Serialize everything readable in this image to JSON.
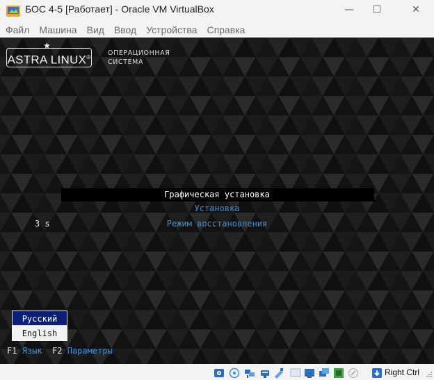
{
  "window": {
    "title": "БОС 4-5 [Работает] - Oracle VM VirtualBox",
    "minimize_glyph": "—",
    "maximize_glyph": "☐",
    "close_glyph": "✕"
  },
  "menubar": {
    "items": [
      "Файл",
      "Машина",
      "Вид",
      "Ввод",
      "Устройства",
      "Справка"
    ]
  },
  "vm": {
    "logo_text": "ASTRA LINUX",
    "logo_reg": "®",
    "logo_subtitle_line1": "ОПЕРАЦИОННАЯ",
    "logo_subtitle_line2": "СИСТЕМА",
    "boot_menu": {
      "items": [
        "Графическая установка",
        "Установка",
        "Режим восстановления"
      ],
      "selected_index": 0
    },
    "timer": "3 s",
    "language_list": [
      "Русский",
      "English"
    ],
    "language_selected": "Русский",
    "fkeys": [
      {
        "key": "F1",
        "label": "Язык"
      },
      {
        "key": "F2",
        "label": "Параметры"
      }
    ],
    "colors": {
      "background": "#141414",
      "selection_bar": "#000000",
      "link_blue": "#3f8fd6",
      "lang_selected_bg": "#0b1f78"
    }
  },
  "statusbar": {
    "icons": [
      "optical-drive-icon",
      "audio-icon",
      "network-icon",
      "usb-icon",
      "shared-folders-icon",
      "display-icon",
      "recording-icon",
      "mouse-integration-icon",
      "cpu-icon",
      "keyboard-capture-icon",
      "arrow-down-icon"
    ],
    "host_key": "Right Ctrl"
  }
}
